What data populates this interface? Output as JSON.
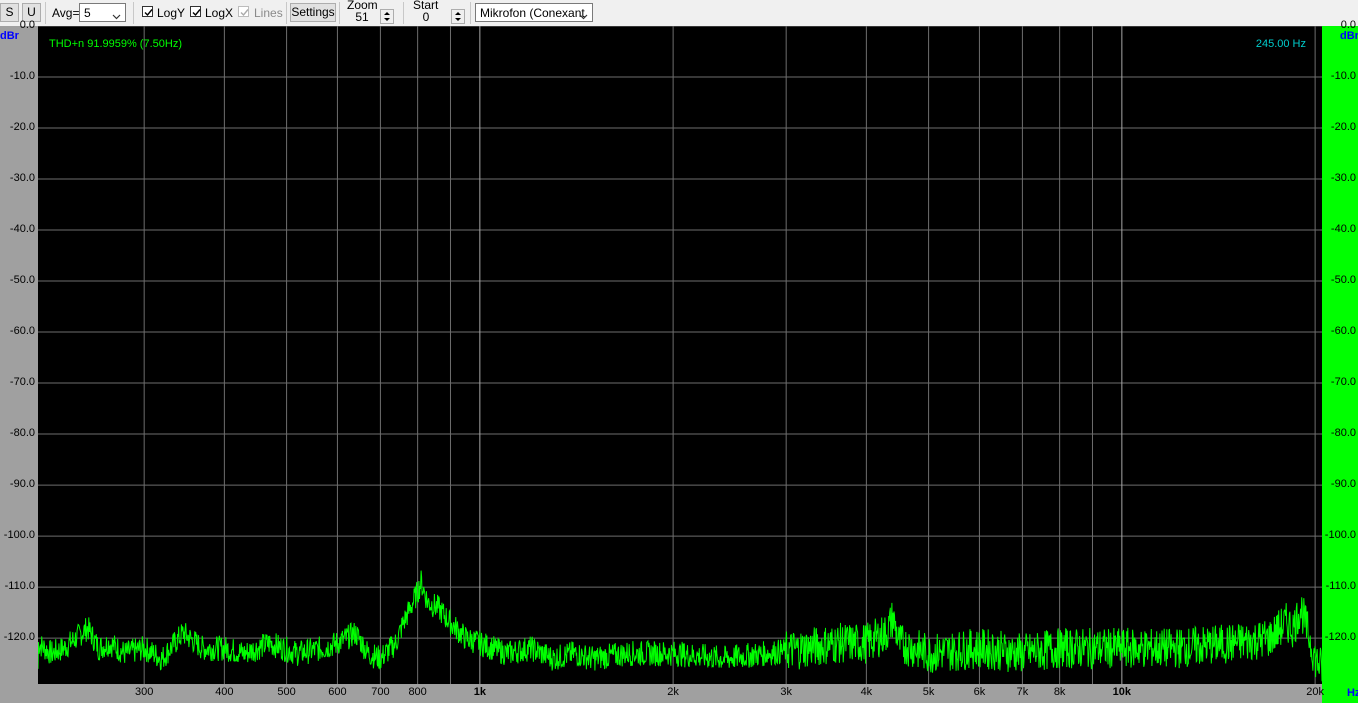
{
  "toolbar": {
    "s_label": "S",
    "u_label": "U",
    "avg_label": "Avg=",
    "avg_value": "5",
    "logy_label": "LogY",
    "logy_checked": true,
    "logx_label": "LogX",
    "logx_checked": true,
    "lines_label": "Lines",
    "lines_checked": true,
    "settings_label": "Settings",
    "zoom_label": "Zoom",
    "zoom_value": "51",
    "start_label": "Start",
    "start_value": "0",
    "device_value": "Mikrofon (Conexant"
  },
  "plot": {
    "thd_text": "THD+n 91.9959% (7.50Hz)",
    "freq_text": "245.00 Hz",
    "y_unit_left": "dBr",
    "y_unit_right": "dBr",
    "x_unit": "Hz",
    "colors": {
      "background": "#000000",
      "trace": "#00ff00",
      "grid": "#6e6e6e",
      "thd_text": "#00ff00",
      "freq_text": "#00cccc",
      "unit_text": "#0000ff",
      "left_panel": "#a0a0a0",
      "right_panel": "#00ff00"
    }
  },
  "chart_data": {
    "type": "line",
    "xscale": "log",
    "xlim": [
      205,
      20500
    ],
    "ylim": [
      -129,
      0
    ],
    "y_ticks": [
      "0.0",
      "-10.0",
      "-20.0",
      "-30.0",
      "-40.0",
      "-50.0",
      "-60.0",
      "-70.0",
      "-80.0",
      "-90.0",
      "-100.0",
      "-110.0",
      "-120.0"
    ],
    "y_tick_values": [
      0,
      -10,
      -20,
      -30,
      -40,
      -50,
      -60,
      -70,
      -80,
      -90,
      -100,
      -110,
      -120
    ],
    "x_ticks": [
      {
        "label": "300",
        "value": 300,
        "bold": false
      },
      {
        "label": "400",
        "value": 400,
        "bold": false
      },
      {
        "label": "500",
        "value": 500,
        "bold": false
      },
      {
        "label": "600",
        "value": 600,
        "bold": false
      },
      {
        "label": "700",
        "value": 700,
        "bold": false
      },
      {
        "label": "800",
        "value": 800,
        "bold": false
      },
      {
        "label": "1k",
        "value": 1000,
        "bold": true
      },
      {
        "label": "2k",
        "value": 2000,
        "bold": false
      },
      {
        "label": "3k",
        "value": 3000,
        "bold": false
      },
      {
        "label": "4k",
        "value": 4000,
        "bold": false
      },
      {
        "label": "5k",
        "value": 5000,
        "bold": false
      },
      {
        "label": "6k",
        "value": 6000,
        "bold": false
      },
      {
        "label": "7k",
        "value": 7000,
        "bold": false
      },
      {
        "label": "8k",
        "value": 8000,
        "bold": false
      },
      {
        "label": "10k",
        "value": 10000,
        "bold": true
      },
      {
        "label": "20k",
        "value": 20000,
        "bold": false
      }
    ],
    "minor_x_gridlines": [
      900,
      9000
    ],
    "series": [
      {
        "points": [
          [
            205,
            -121
          ],
          [
            215,
            -123
          ],
          [
            225,
            -122
          ],
          [
            235,
            -120
          ],
          [
            245,
            -118
          ],
          [
            255,
            -122
          ],
          [
            265,
            -121
          ],
          [
            280,
            -123
          ],
          [
            300,
            -122
          ],
          [
            320,
            -124
          ],
          [
            345,
            -119
          ],
          [
            370,
            -122
          ],
          [
            400,
            -122
          ],
          [
            430,
            -123
          ],
          [
            470,
            -121
          ],
          [
            520,
            -123
          ],
          [
            570,
            -122
          ],
          [
            600,
            -121
          ],
          [
            640,
            -119
          ],
          [
            670,
            -123
          ],
          [
            700,
            -124
          ],
          [
            740,
            -121
          ],
          [
            760,
            -117
          ],
          [
            780,
            -114
          ],
          [
            800,
            -111
          ],
          [
            810,
            -109
          ],
          [
            830,
            -113
          ],
          [
            860,
            -114
          ],
          [
            900,
            -117
          ],
          [
            950,
            -120
          ],
          [
            1000,
            -121
          ],
          [
            1100,
            -123
          ],
          [
            1200,
            -122
          ],
          [
            1300,
            -124
          ],
          [
            1400,
            -123
          ],
          [
            1500,
            -124
          ],
          [
            1700,
            -123
          ],
          [
            2000,
            -123
          ],
          [
            2400,
            -124
          ],
          [
            2800,
            -123
          ],
          [
            3200,
            -122
          ],
          [
            3600,
            -121
          ],
          [
            4000,
            -121
          ],
          [
            4300,
            -119
          ],
          [
            4400,
            -116
          ],
          [
            4500,
            -121
          ],
          [
            5000,
            -123
          ],
          [
            6000,
            -122
          ],
          [
            7000,
            -123
          ],
          [
            8000,
            -122
          ],
          [
            10000,
            -122
          ],
          [
            12000,
            -122
          ],
          [
            15000,
            -121
          ],
          [
            17000,
            -120
          ],
          [
            18000,
            -117
          ],
          [
            18500,
            -118
          ],
          [
            19000,
            -114
          ],
          [
            19500,
            -119
          ],
          [
            20000,
            -124
          ],
          [
            20500,
            -126
          ]
        ]
      }
    ]
  }
}
